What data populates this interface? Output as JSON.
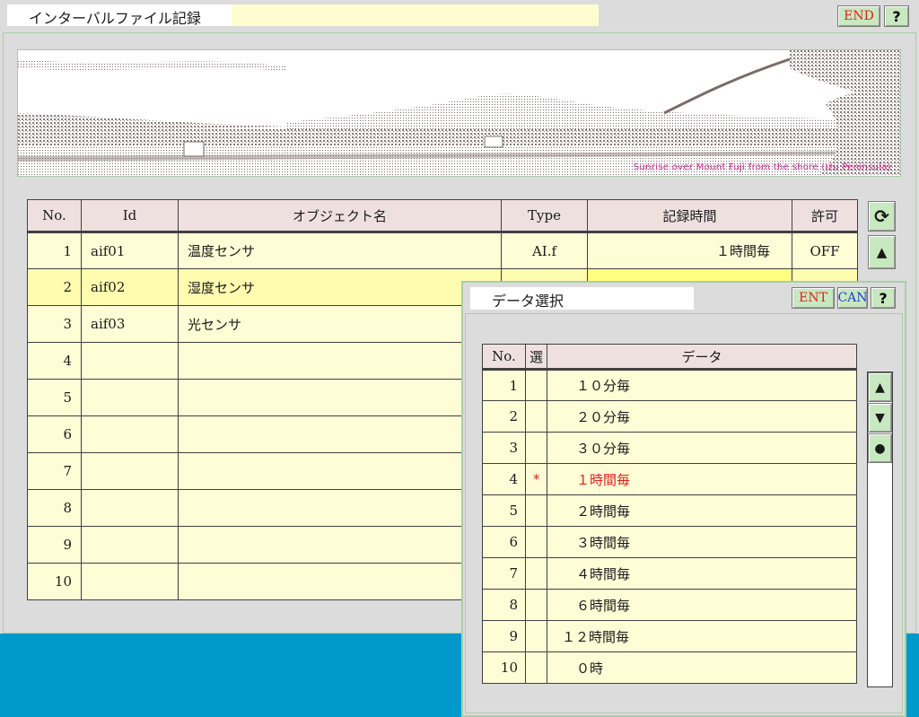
{
  "window": {
    "title": "インターバルファイル記録",
    "end_label": "END",
    "help_label": "?"
  },
  "banner": {
    "credit": "Sunrise over Mount Fuji from the shore (Izu Peninsula)"
  },
  "main_table": {
    "headers": [
      "No.",
      "Id",
      "オブジェクト名",
      "Type",
      "記録時間",
      "許可"
    ],
    "rows": [
      {
        "no": "1",
        "id": "aif01",
        "name": "温度センサ",
        "type": "AI.f",
        "time": "１時間毎",
        "perm": "OFF"
      },
      {
        "no": "2",
        "id": "aif02",
        "name": "湿度センサ",
        "type": "",
        "time": "",
        "perm": ""
      },
      {
        "no": "3",
        "id": "aif03",
        "name": "光センサ",
        "type": "",
        "time": "",
        "perm": ""
      },
      {
        "no": "4",
        "id": "",
        "name": "",
        "type": "",
        "time": "",
        "perm": ""
      },
      {
        "no": "5",
        "id": "",
        "name": "",
        "type": "",
        "time": "",
        "perm": ""
      },
      {
        "no": "6",
        "id": "",
        "name": "",
        "type": "",
        "time": "",
        "perm": ""
      },
      {
        "no": "7",
        "id": "",
        "name": "",
        "type": "",
        "time": "",
        "perm": ""
      },
      {
        "no": "8",
        "id": "",
        "name": "",
        "type": "",
        "time": "",
        "perm": ""
      },
      {
        "no": "9",
        "id": "",
        "name": "",
        "type": "",
        "time": "",
        "perm": ""
      },
      {
        "no": "10",
        "id": "",
        "name": "",
        "type": "",
        "time": "",
        "perm": ""
      }
    ],
    "selected_row": 2,
    "side_buttons": {
      "refresh": "⟳",
      "up": "▲"
    }
  },
  "dialog": {
    "title": "データ選択",
    "ent_label": "ENT",
    "can_label": "CAN",
    "help_label": "?",
    "headers": [
      "No.",
      "選",
      "データ"
    ],
    "rows": [
      {
        "no": "1",
        "mark": "",
        "data": "１０分毎"
      },
      {
        "no": "2",
        "mark": "",
        "data": "２０分毎"
      },
      {
        "no": "3",
        "mark": "",
        "data": "３０分毎"
      },
      {
        "no": "4",
        "mark": "*",
        "data": "１時間毎"
      },
      {
        "no": "5",
        "mark": "",
        "data": "２時間毎"
      },
      {
        "no": "6",
        "mark": "",
        "data": "３時間毎"
      },
      {
        "no": "7",
        "mark": "",
        "data": "４時間毎"
      },
      {
        "no": "8",
        "mark": "",
        "data": "６時間毎"
      },
      {
        "no": "9",
        "mark": "",
        "data": "１２時間毎"
      },
      {
        "no": "10",
        "mark": "",
        "data": "０時"
      }
    ],
    "scroll_buttons": {
      "up": "▲",
      "down": "▼",
      "select": "●"
    }
  },
  "colors": {
    "cell_yellow": "#fffdd6",
    "header_pink": "#efe0e0",
    "button_green": "#c8e8c0",
    "accent_red": "#e02020",
    "accent_blue": "#1f3fd0",
    "bottom_blue": "#0099cc"
  }
}
